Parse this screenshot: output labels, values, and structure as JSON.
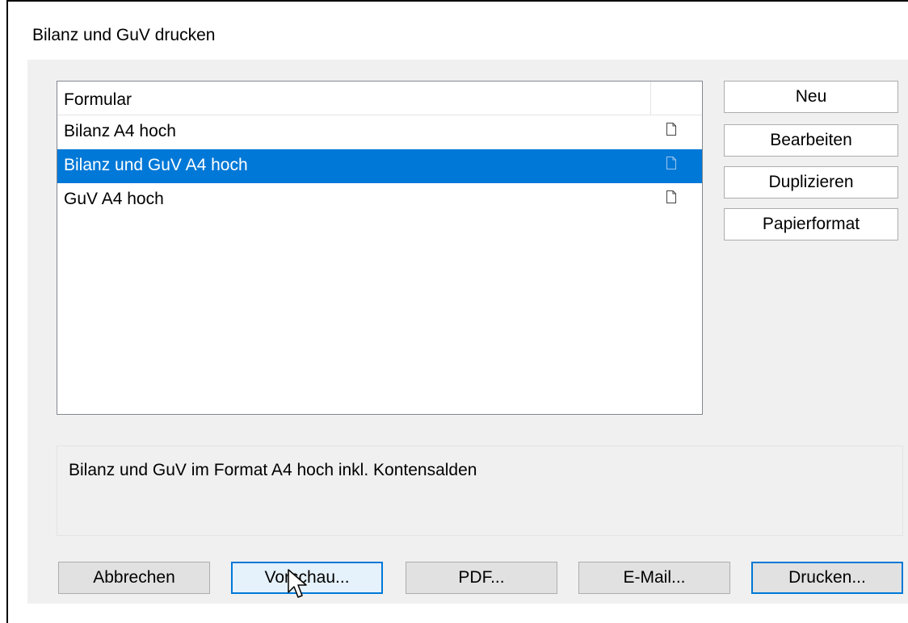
{
  "window": {
    "title": "Bilanz und GuV drucken"
  },
  "list": {
    "header": "Formular",
    "rows": [
      {
        "label": "Bilanz A4 hoch",
        "icon": "document-icon",
        "selected": false
      },
      {
        "label": "Bilanz und GuV A4 hoch",
        "icon": "document-icon",
        "selected": true
      },
      {
        "label": "GuV A4 hoch",
        "icon": "document-icon",
        "selected": false
      }
    ]
  },
  "side_buttons": {
    "new": "Neu",
    "edit": "Bearbeiten",
    "duplicate": "Duplizieren",
    "paper_format": "Papierformat"
  },
  "description": "Bilanz und GuV im Format A4 hoch inkl. Kontensalden",
  "bottom_buttons": {
    "cancel": "Abbrechen",
    "preview": "Vorschau...",
    "pdf": "PDF...",
    "email": "E-Mail...",
    "print": "Drucken..."
  },
  "colors": {
    "selection": "#0078d7",
    "dialog_bg": "#f0f0f0",
    "button_bg": "#e1e1e1"
  }
}
